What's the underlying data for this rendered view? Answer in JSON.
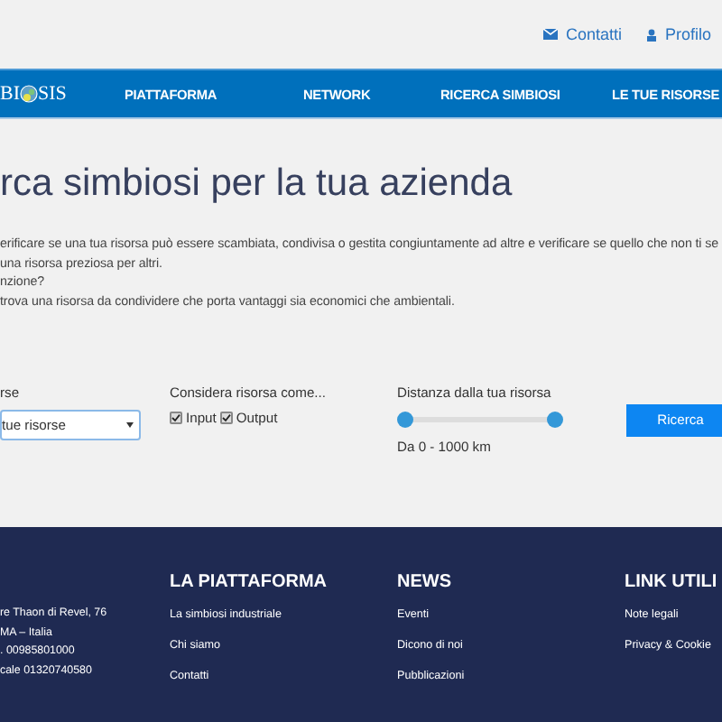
{
  "top_links": [
    "Contatti",
    "Profilo"
  ],
  "logo": {
    "left": "BI",
    "right": "SIS"
  },
  "nav": [
    {
      "label": "PIATTAFORMA"
    },
    {
      "label": "NETWORK"
    },
    {
      "label": "RICERCA SIMBIOSI"
    },
    {
      "label": "LE TUE RISORSE"
    }
  ],
  "title": "rca simbiosi per la tua azienda",
  "intro": [
    "erificare se una tua risorsa può essere scambiata, condivisa o gestita congiuntamente ad altre e verificare se quello che non ti se",
    "una risorsa preziosa per altri.",
    "nzione?",
    "trova una risorsa da condividere che porta vantaggi sia economici che ambientali."
  ],
  "search": {
    "resource_label": "rse",
    "resource_select": "tue risorse",
    "consider_label": "Considera risorsa come...",
    "options": [
      {
        "label": "Input",
        "checked": true
      },
      {
        "label": "Output",
        "checked": true
      }
    ],
    "distance_label": "Distanza dalla tua risorsa",
    "distance": {
      "level": 1
    },
    "distance_reading": "Da 0 - 1000 km",
    "button": "Ricerca"
  },
  "footer": {
    "address": [
      "re Thaon di Revel, 76",
      "MA – Italia",
      ". 00985801000",
      "cale 01320740580"
    ],
    "columns": [
      {
        "heading": "LA PIATTAFORMA",
        "links": [
          "La simbiosi industriale",
          "Chi siamo",
          "Contatti"
        ]
      },
      {
        "heading": "NEWS",
        "links": [
          "Eventi",
          "Dicono di noi",
          "Pubblicazioni"
        ]
      },
      {
        "heading": "LINK UTILI",
        "links": [
          "Note legali",
          "Privacy & Cookie"
        ]
      }
    ]
  }
}
